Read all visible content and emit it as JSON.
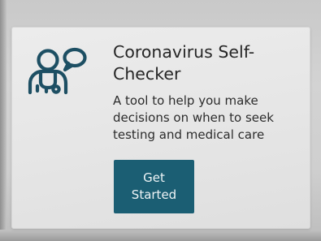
{
  "card": {
    "icon": "doctor-chat-icon",
    "title": "Coronavirus Self-Checker",
    "description": "A tool to help you make decisions on when to seek testing and medical care",
    "button_label": "Get Started"
  },
  "colors": {
    "accent": "#1b5e73",
    "icon_stroke": "#1d4f63",
    "text": "#262626",
    "card_background": "#e8e8e8"
  }
}
